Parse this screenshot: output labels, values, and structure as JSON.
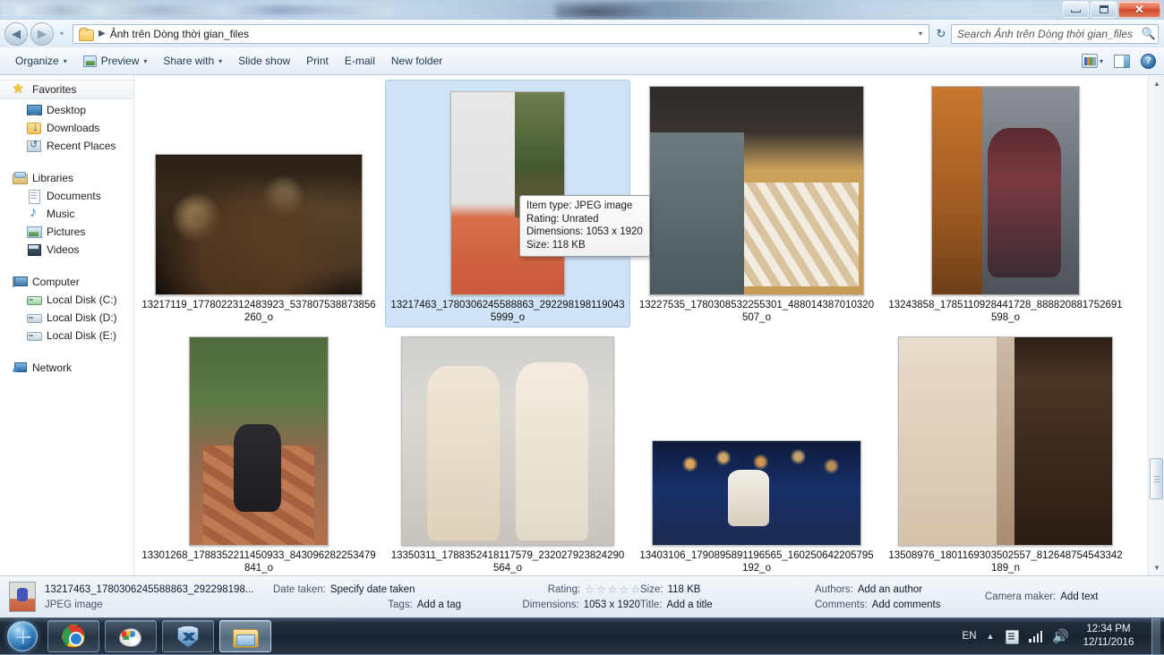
{
  "window": {
    "controls": {
      "minimize": "–",
      "maximize": "❐",
      "close": "✕"
    }
  },
  "address_bar": {
    "back_icon": "◀",
    "forward_icon": "▶",
    "history_caret": "▾",
    "folder_icon": "folder-icon",
    "breadcrumb": "Ảnh trên Dòng thời gian_files",
    "breadcrumb_sep": "▶",
    "dropdown_caret": "▾",
    "refresh_icon": "↻"
  },
  "search": {
    "placeholder": "Search Ảnh trên Dòng thời gian_files",
    "value": "",
    "icon": "search-icon"
  },
  "toolbar": {
    "organize": "Organize",
    "preview": "Preview",
    "share_with": "Share with",
    "slide_show": "Slide show",
    "print": "Print",
    "email": "E-mail",
    "new_folder": "New folder",
    "caret": "▾",
    "help_glyph": "?"
  },
  "sidebar": {
    "groups": [
      {
        "header": {
          "label": "Favorites",
          "icon": "star-icon"
        },
        "items": [
          {
            "label": "Desktop",
            "icon": "desktop-icon"
          },
          {
            "label": "Downloads",
            "icon": "downloads-icon"
          },
          {
            "label": "Recent Places",
            "icon": "recent-places-icon"
          }
        ]
      },
      {
        "header": {
          "label": "Libraries",
          "icon": "libraries-icon"
        },
        "items": [
          {
            "label": "Documents",
            "icon": "document-icon"
          },
          {
            "label": "Music",
            "icon": "music-icon"
          },
          {
            "label": "Pictures",
            "icon": "pictures-icon"
          },
          {
            "label": "Videos",
            "icon": "videos-icon"
          }
        ]
      },
      {
        "header": {
          "label": "Computer",
          "icon": "computer-icon"
        },
        "items": [
          {
            "label": "Local Disk (C:)",
            "icon": "system-disk-icon"
          },
          {
            "label": "Local Disk (D:)",
            "icon": "disk-icon"
          },
          {
            "label": "Local Disk (E:)",
            "icon": "disk-icon"
          }
        ]
      },
      {
        "header": {
          "label": "Network",
          "icon": "network-icon"
        },
        "items": []
      }
    ]
  },
  "files": [
    {
      "name": "13217119_1778022312483923_537807538873856260_o",
      "selected": false
    },
    {
      "name": "13217463_1780306245588863_2922981981190435999_o",
      "selected": true
    },
    {
      "name": "13227535_1780308532255301_488014387010320507_o",
      "selected": false
    },
    {
      "name": "13243858_1785110928441728_888820881752691598_o",
      "selected": false
    },
    {
      "name": "13301268_1788352211450933_843096282253479841_o",
      "selected": false
    },
    {
      "name": "13350311_1788352418117579_232027923824290564_o",
      "selected": false
    },
    {
      "name": "13403106_1790895891196565_160250642205795192_o",
      "selected": false
    },
    {
      "name": "13508976_1801169303502557_812648754543342189_n",
      "selected": false
    }
  ],
  "tooltip": {
    "item_type": "Item type: JPEG image",
    "rating": "Rating: Unrated",
    "dimensions": "Dimensions: 1053 x 1920",
    "size": "Size: 118 KB"
  },
  "details_pane": {
    "file_name": "13217463_1780306245588863_292298198...",
    "file_type": "JPEG image",
    "date_taken_label": "Date taken:",
    "date_taken_value": "Specify date taken",
    "tags_label": "Tags:",
    "tags_value": "Add a tag",
    "rating_label": "Rating:",
    "rating_stars": [
      "☆",
      "☆",
      "☆",
      "☆",
      "☆"
    ],
    "dimensions_label": "Dimensions:",
    "dimensions_value": "1053 x 1920",
    "size_label": "Size:",
    "size_value": "118 KB",
    "title_label": "Title:",
    "title_value": "Add a title",
    "authors_label": "Authors:",
    "authors_value": "Add an author",
    "comments_label": "Comments:",
    "comments_value": "Add comments",
    "camera_maker_label": "Camera maker:",
    "camera_maker_value": "Add text"
  },
  "scrollbar": {
    "up": "▲",
    "down": "▼"
  },
  "taskbar": {
    "start": "start-orb",
    "buttons": [
      {
        "name": "chrome",
        "icon": "chrome-icon",
        "active": false
      },
      {
        "name": "paint",
        "icon": "paint-icon",
        "active": false
      },
      {
        "name": "security",
        "icon": "shield-icon",
        "active": false
      },
      {
        "name": "explorer",
        "icon": "explorer-icon",
        "active": true
      }
    ],
    "tray": {
      "language": "EN",
      "show_hidden": "▲",
      "action_center_icon": "action-center-icon",
      "network_icon": "network-signal-icon",
      "volume_icon": "🔊",
      "time": "12:34 PM",
      "date": "12/11/2016"
    }
  },
  "colors": {
    "selection": "#cfe3f7",
    "accent": "#2a5c86",
    "close_button": "#cf4526"
  }
}
